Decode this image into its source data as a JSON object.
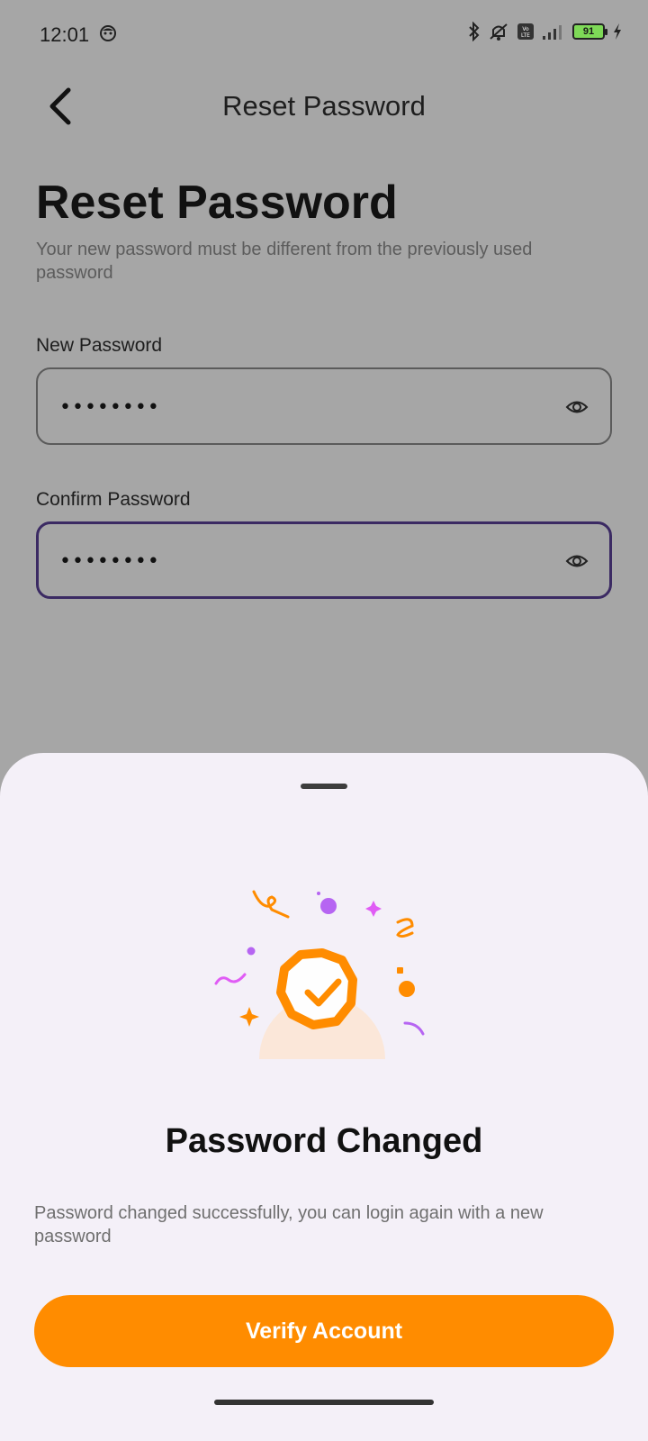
{
  "status_bar": {
    "time": "12:01",
    "battery_level": "91",
    "icons": [
      "alarm-face-icon",
      "bluetooth-icon",
      "mute-icon",
      "volte-icon",
      "signal-icon",
      "battery-icon",
      "charging-icon"
    ]
  },
  "app_bar": {
    "title": "Reset Password",
    "back_icon": "chevron-left-icon"
  },
  "page": {
    "heading": "Reset Password",
    "subtitle": "Your new password must be different from the previously used password"
  },
  "form": {
    "new_password": {
      "label": "New Password",
      "value": "••••••••"
    },
    "confirm_password": {
      "label": "Confirm Password",
      "value": "••••••••"
    }
  },
  "sheet": {
    "title": "Password Changed",
    "description": "Password changed successfully, you can login again with a new password",
    "button_label": "Verify Account"
  },
  "colors": {
    "accent": "#ff8c00",
    "focus_border": "#3b2a63",
    "confetti_purple": "#b665f2",
    "confetti_pink": "#e05cf5"
  }
}
